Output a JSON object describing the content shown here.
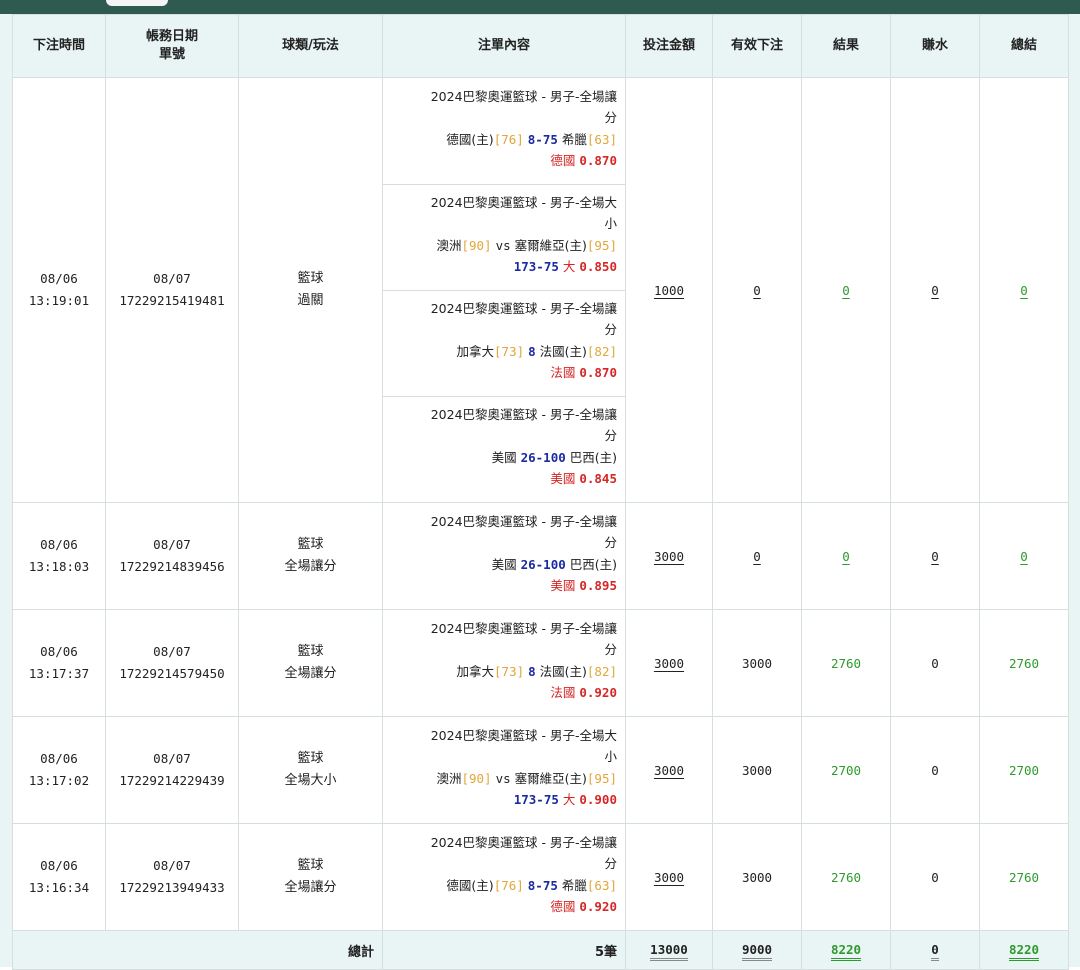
{
  "headers": {
    "time": "下注時間",
    "date_l1": "帳務日期",
    "date_l2": "單號",
    "sport": "球類/玩法",
    "content": "注單內容",
    "amount": "投注金額",
    "valid": "有效下注",
    "result": "結果",
    "commission": "賺水",
    "total": "總結"
  },
  "rows": [
    {
      "date": "08/06",
      "clock": "13:19:01",
      "acct_date": "08/07",
      "ticket": "17229215419481",
      "sport": "籃球",
      "play": "過關",
      "legs": [
        {
          "league": "2024巴黎奧運籃球 - 男子-全場讓",
          "league_tail": "分",
          "team_a": "德國(主)",
          "team_a_score": "[76]",
          "handicap": "8-75",
          "team_b": "希臘",
          "team_b_score": "[63]",
          "pick": "德國",
          "odds": "0.870"
        },
        {
          "league": "2024巴黎奧運籃球 - 男子-全場大",
          "league_tail": "小",
          "team_a": "澳洲",
          "team_a_score": "[90]",
          "vs": "vs",
          "team_b": "塞爾維亞(主)",
          "team_b_score": "[95]",
          "line": "173-75",
          "pick": "大",
          "odds": "0.850"
        },
        {
          "league": "2024巴黎奧運籃球 - 男子-全場讓",
          "league_tail": "分",
          "team_a": "加拿大",
          "team_a_score": "[73]",
          "handicap": "8",
          "team_b": "法國(主)",
          "team_b_score": "[82]",
          "pick": "法國",
          "odds": "0.870"
        },
        {
          "league": "2024巴黎奧運籃球 - 男子-全場讓",
          "league_tail": "分",
          "team_a": "美國",
          "handicap": "26-100",
          "team_b": "巴西(主)",
          "pick": "美國",
          "odds": "0.845"
        }
      ],
      "amount": "1000",
      "valid": "0",
      "result": "0",
      "commission": "0",
      "total": "0"
    },
    {
      "date": "08/06",
      "clock": "13:18:03",
      "acct_date": "08/07",
      "ticket": "17229214839456",
      "sport": "籃球",
      "play": "全場讓分",
      "legs": [
        {
          "league": "2024巴黎奧運籃球 - 男子-全場讓",
          "league_tail": "分",
          "team_a": "美國",
          "handicap": "26-100",
          "team_b": "巴西(主)",
          "pick": "美國",
          "odds": "0.895"
        }
      ],
      "amount": "3000",
      "valid": "0",
      "result": "0",
      "commission": "0",
      "total": "0"
    },
    {
      "date": "08/06",
      "clock": "13:17:37",
      "acct_date": "08/07",
      "ticket": "17229214579450",
      "sport": "籃球",
      "play": "全場讓分",
      "legs": [
        {
          "league": "2024巴黎奧運籃球 - 男子-全場讓",
          "league_tail": "分",
          "team_a": "加拿大",
          "team_a_score": "[73]",
          "handicap": "8",
          "team_b": "法國(主)",
          "team_b_score": "[82]",
          "pick": "法國",
          "odds": "0.920"
        }
      ],
      "amount": "3000",
      "valid": "3000",
      "result": "2760",
      "commission": "0",
      "total": "2760"
    },
    {
      "date": "08/06",
      "clock": "13:17:02",
      "acct_date": "08/07",
      "ticket": "17229214229439",
      "sport": "籃球",
      "play": "全場大小",
      "legs": [
        {
          "league": "2024巴黎奧運籃球 - 男子-全場大",
          "league_tail": "小",
          "team_a": "澳洲",
          "team_a_score": "[90]",
          "vs": "vs",
          "team_b": "塞爾維亞(主)",
          "team_b_score": "[95]",
          "line": "173-75",
          "pick": "大",
          "odds": "0.900"
        }
      ],
      "amount": "3000",
      "valid": "3000",
      "result": "2700",
      "commission": "0",
      "total": "2700"
    },
    {
      "date": "08/06",
      "clock": "13:16:34",
      "acct_date": "08/07",
      "ticket": "17229213949433",
      "sport": "籃球",
      "play": "全場讓分",
      "legs": [
        {
          "league": "2024巴黎奧運籃球 - 男子-全場讓",
          "league_tail": "分",
          "team_a": "德國(主)",
          "team_a_score": "[76]",
          "handicap": "8-75",
          "team_b": "希臘",
          "team_b_score": "[63]",
          "pick": "德國",
          "odds": "0.920"
        }
      ],
      "amount": "3000",
      "valid": "3000",
      "result": "2760",
      "commission": "0",
      "total": "2760"
    }
  ],
  "footer": {
    "label": "總計",
    "count": "5筆",
    "amount": "13000",
    "valid": "9000",
    "result": "8220",
    "commission": "0",
    "total": "8220"
  },
  "colors": {
    "header_bar": "#2f5a4f",
    "header_bg": "#e9f5f4",
    "score_gold": "#e0a73a",
    "handicap_navy": "#1b2aa0",
    "pick_red": "#d62626",
    "result_green": "#2e9a2e"
  }
}
